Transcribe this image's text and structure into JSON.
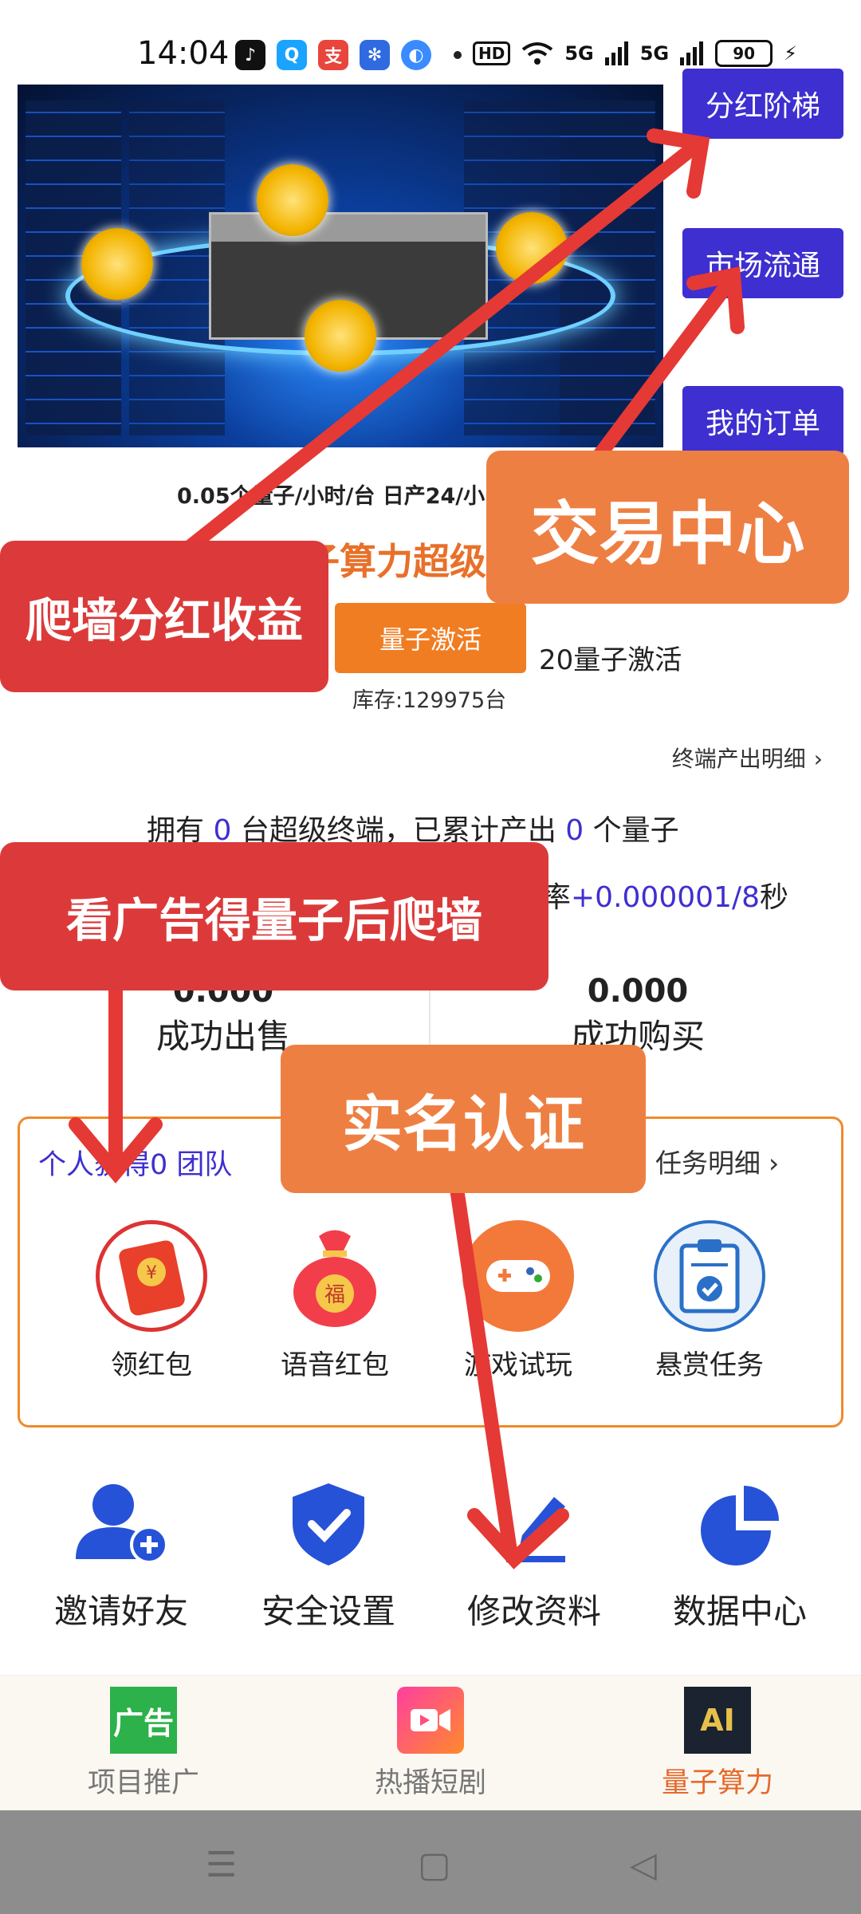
{
  "status_bar": {
    "time": "14:04",
    "app_icons": [
      "tiktok-icon",
      "qq-icon",
      "alipay-icon",
      "baidu-icon",
      "browser-icon"
    ],
    "hd_badge": "HD",
    "network_1": "5G",
    "network_2": "5G",
    "battery": "90"
  },
  "side_menu": {
    "dividend_ladder": "分红阶梯",
    "market": "市场流通",
    "my_orders": "我的订单"
  },
  "product": {
    "rate_line": "0.05个量子/小时/台 日产24/小",
    "title": "子算力超级",
    "activate_button": "量子激活",
    "activate_cost": "20量子激活",
    "stock": "库存:129975台"
  },
  "detail_link": "终端产出明细",
  "ownership": {
    "prefix": "拥有",
    "count": "0",
    "mid": "台超级终端，已累计产出",
    "produced": "0",
    "suffix": "个量子"
  },
  "speed": {
    "prefix": "率",
    "value": "+0.000001/8",
    "suffix": "秒"
  },
  "stats": {
    "sold_value": "0.000",
    "sold_label": "成功出售",
    "bought_value": "0.000",
    "bought_label": "成功购买"
  },
  "tasks": {
    "summary": "个人获得0 团队",
    "detail_link": "任务明细",
    "items": [
      {
        "label": "领红包",
        "icon": "red-envelope-icon"
      },
      {
        "label": "语音红包",
        "icon": "lucky-bag-icon"
      },
      {
        "label": "游戏试玩",
        "icon": "gamepad-icon"
      },
      {
        "label": "悬赏任务",
        "icon": "clipboard-icon"
      }
    ]
  },
  "quick_actions": [
    {
      "label": "邀请好友",
      "icon": "add-user-icon"
    },
    {
      "label": "安全设置",
      "icon": "shield-icon"
    },
    {
      "label": "修改资料",
      "icon": "edit-icon"
    },
    {
      "label": "数据中心",
      "icon": "pie-chart-icon"
    }
  ],
  "tabs": [
    {
      "label": "项目推广",
      "icon": "promo-icon",
      "icon_text": "广告"
    },
    {
      "label": "热播短剧",
      "icon": "video-icon"
    },
    {
      "label": "量子算力",
      "icon": "ai-chip-icon",
      "icon_text": "AI"
    }
  ],
  "annotations": {
    "trade_center": "交易中心",
    "wall_dividend": "爬墙分红收益",
    "watch_ads": "看广告得量子后爬墙",
    "real_name": "实名认证"
  },
  "colors": {
    "accent_purple": "#3e2fd0",
    "accent_orange": "#f07d22",
    "annotation_red": "#dc3a3a",
    "annotation_orange": "#ee7f42",
    "tab_active": "#e66a2c"
  }
}
